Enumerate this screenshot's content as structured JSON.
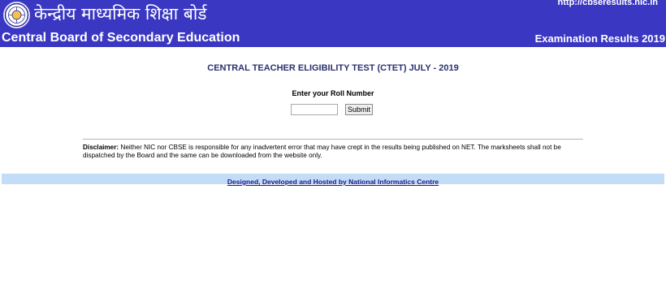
{
  "header": {
    "site_url": "http://cbseresults.nic.in",
    "hindi_title": "केन्द्रीय माध्यमिक शिक्षा बोर्ड",
    "english_title": "Central Board of Secondary Education",
    "results_title": "Examination Results 2019",
    "logo_icon": "cbse-emblem-icon",
    "background_color": "#3a37c2"
  },
  "main": {
    "exam_title": "CENTRAL TEACHER ELIGIBILITY TEST (CTET) JULY - 2019",
    "roll_label": "Enter your Roll Number",
    "roll_input_value": "",
    "submit_label": "Submit"
  },
  "disclaimer": {
    "label": "Disclaimer:",
    "text": " Neither NIC nor CBSE is responsible for any inadvertent error that may have crept in the results being published on NET. The marksheets shall not be dispatched by the Board and the same can be downloaded from the website only."
  },
  "footer": {
    "link_text": "Designed, Developed and Hosted by National Informatics Centre",
    "background_color": "#c4ddf7"
  }
}
